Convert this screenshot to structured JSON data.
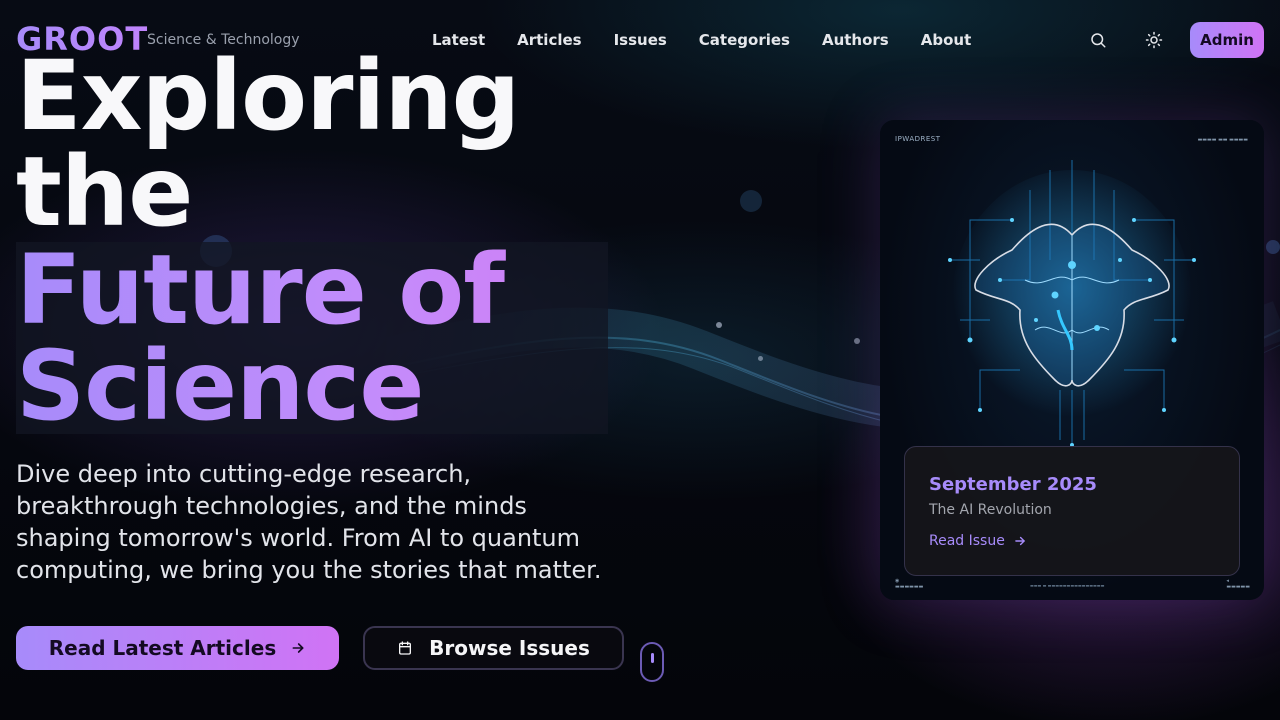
{
  "brand": {
    "logo": "GROOT",
    "tagline": "Science & Technology"
  },
  "nav": {
    "items": [
      "Latest",
      "Articles",
      "Issues",
      "Categories",
      "Authors",
      "About"
    ],
    "search_icon": "search-icon",
    "theme_icon": "sun-icon",
    "admin_label": "Admin"
  },
  "hero": {
    "title_line1": "Exploring",
    "title_line2": "the",
    "title_line3": "Future of",
    "title_line4": "Science",
    "description": "Dive deep into cutting-edge research, breakthrough technologies, and the minds shaping tomorrow's world. From AI to quantum computing, we bring you the stories that matter.",
    "primary_button": "Read Latest Articles",
    "secondary_button": "Browse Issues"
  },
  "issue": {
    "month": "September 2025",
    "theme": "The AI Revolution",
    "link": "Read Issue",
    "cover_masthead": "IPWADREST"
  },
  "colors": {
    "accent": "#a78bfa",
    "accent2": "#d073f5",
    "background": "#05070d"
  }
}
